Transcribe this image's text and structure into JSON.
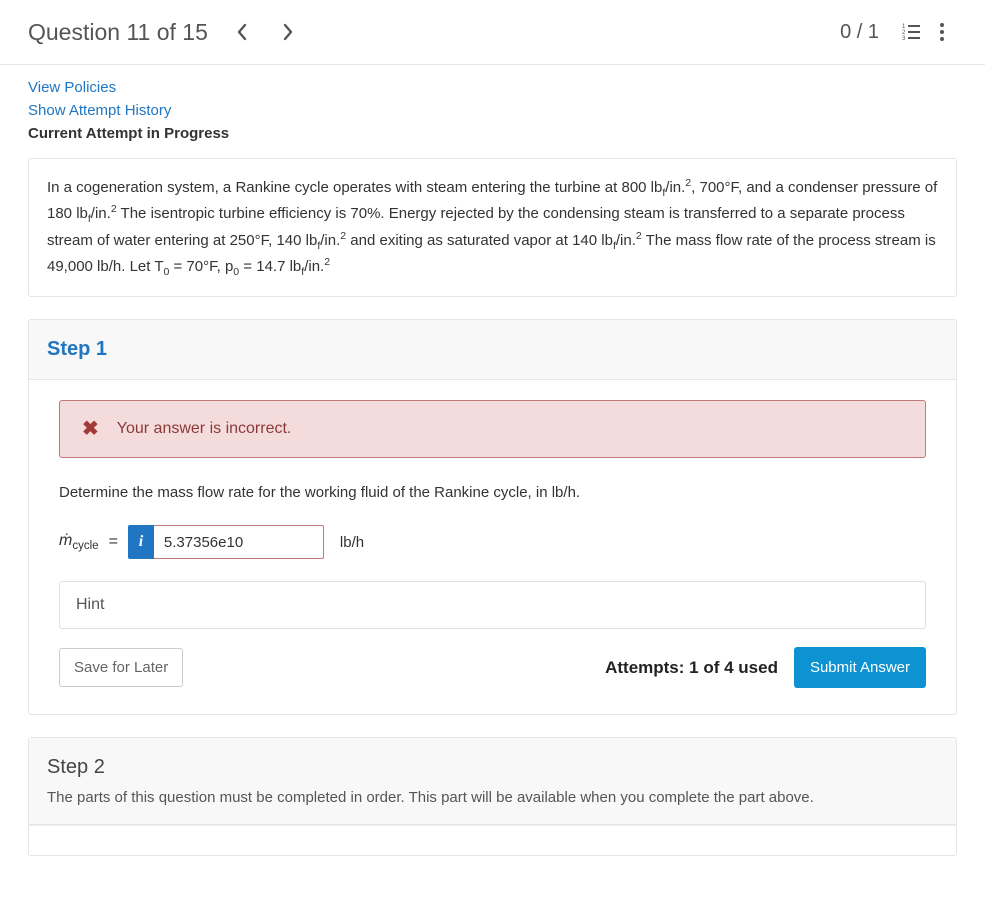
{
  "header": {
    "title": "Question 11 of 15",
    "score": "0 / 1"
  },
  "links": {
    "view_policies": "View Policies",
    "attempt_history": "Show Attempt History"
  },
  "status_line": "Current Attempt in Progress",
  "problem_html": "In a cogeneration system, a Rankine cycle operates with steam entering the turbine at 800 lb<sub>f</sub>/in.<sup>2</sup>, 700°F, and a condenser pressure of 180 lb<sub>f</sub>/in.<sup>2</sup> The isentropic turbine efficiency is 70%. Energy rejected by the condensing steam is transferred to a separate process stream of water entering at 250°F, 140 lb<sub>f</sub>/in.<sup>2</sup> and exiting as saturated vapor at 140 lb<sub>f</sub>/in.<sup>2</sup>  The mass flow rate of the process stream is 49,000 lb/h.  Let T<sub>0</sub> = 70°F, p<sub>0</sub> = 14.7 lb<sub>f</sub>/in.<sup>2</sup>",
  "step1": {
    "title": "Step 1",
    "error_msg": "Your answer is incorrect.",
    "prompt": "Determine the mass flow rate for the working fluid of the Rankine cycle, in lb/h.",
    "var_html": "<i>ṁ</i><sub>cycle</sub>",
    "eq": "=",
    "info_glyph": "i",
    "answer_value": "5.37356e10",
    "unit": "lb/h",
    "hint_label": "Hint",
    "save_label": "Save for Later",
    "attempts_label": "Attempts: 1 of 4 used",
    "submit_label": "Submit Answer"
  },
  "step2": {
    "title": "Step 2",
    "locked_msg": "The parts of this question must be completed in order. This part will be available when you complete the part above."
  }
}
